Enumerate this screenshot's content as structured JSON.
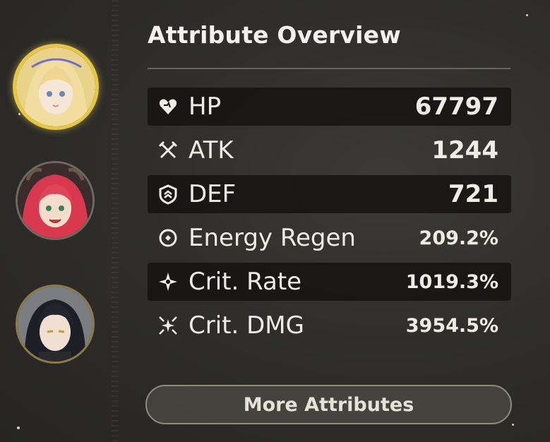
{
  "panel": {
    "title": "Attribute Overview"
  },
  "party": [
    {
      "name": "portrait-1",
      "selected": true
    },
    {
      "name": "portrait-2",
      "selected": false
    },
    {
      "name": "portrait-3",
      "selected": false
    }
  ],
  "attributes": [
    {
      "label": "HP",
      "value": "67797",
      "icon": "hp-heart-icon"
    },
    {
      "label": "ATK",
      "value": "1244",
      "icon": "atk-swords-icon"
    },
    {
      "label": "DEF",
      "value": "721",
      "icon": "def-shield-icon"
    },
    {
      "label": "Energy Regen",
      "value": "209.2%",
      "icon": "energy-regen-icon"
    },
    {
      "label": "Crit. Rate",
      "value": "1019.3%",
      "icon": "crit-rate-icon"
    },
    {
      "label": "Crit. DMG",
      "value": "3954.5%",
      "icon": "crit-dmg-icon"
    }
  ],
  "buttons": {
    "more_attributes": "More Attributes"
  },
  "colors": {
    "selected_ring": "#e7c643",
    "row_dark": "#121110",
    "text": "#efece4"
  }
}
